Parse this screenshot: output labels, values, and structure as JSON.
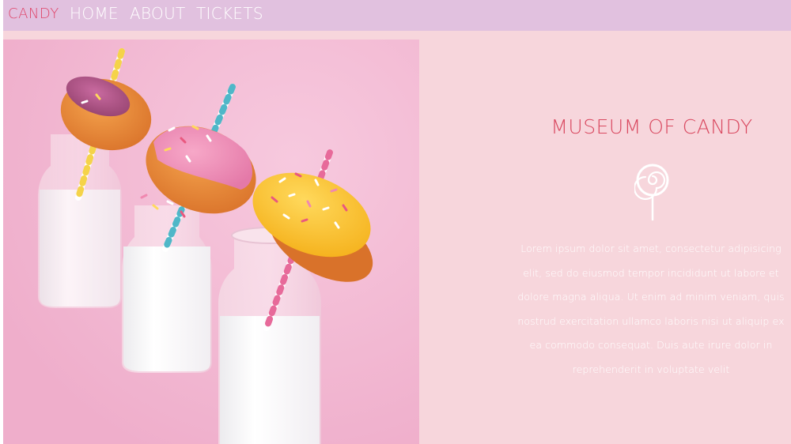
{
  "colors": {
    "accent": "#e0466a",
    "nav_background": "#e1c1df",
    "nav_link": "#ffffff",
    "panel_background": "#f7d6dc",
    "title": "#d9485f",
    "body_text": "#ffffff"
  },
  "nav": {
    "logo": "CANDY",
    "links": [
      {
        "label": "HOME"
      },
      {
        "label": "ABOUT"
      },
      {
        "label": "TICKETS"
      }
    ]
  },
  "hero": {
    "image_icon": "donuts-on-milk-bottles-photo"
  },
  "info": {
    "title": "MUSEUM OF CANDY",
    "icon": "lollipop-icon",
    "description": "Lorem ipsum dolor sit amet, consectetur adipisicing elit, sed do eiusmod tempor incididunt ut labore et dolore magna aliqua. Ut enim ad minim veniam, quis nostrud exercitation ullamco laboris nisi ut aliquip ex ea commodo consequat. Duis aute irure dolor in reprehenderit in voluptate velit"
  }
}
